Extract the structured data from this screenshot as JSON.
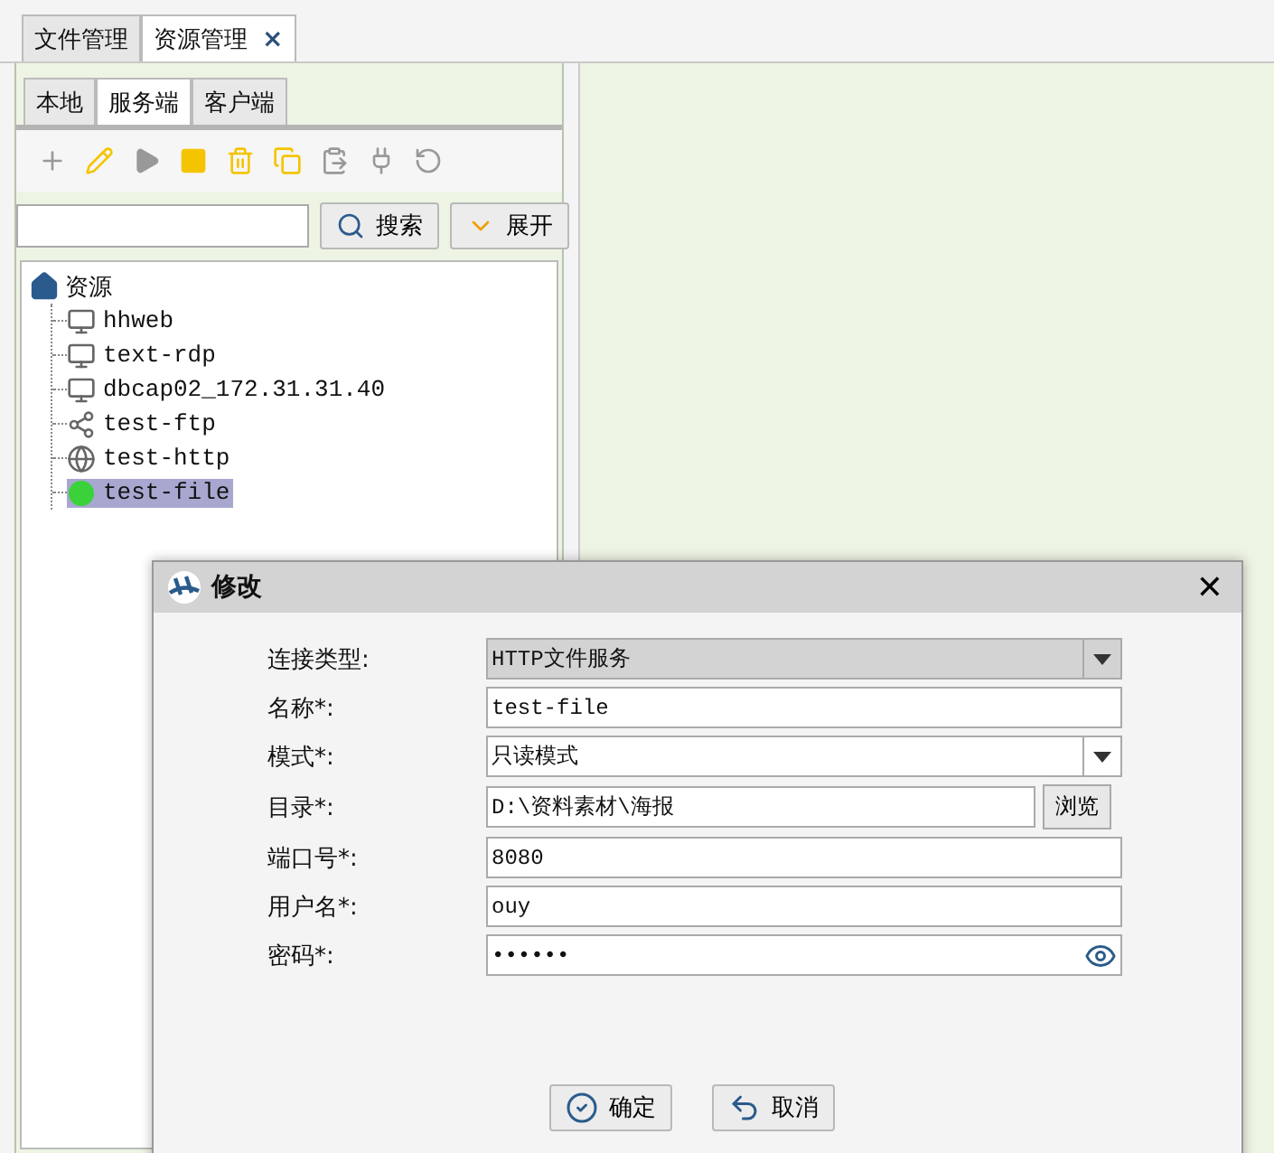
{
  "top_tabs": [
    {
      "label": "文件管理",
      "selected": false
    },
    {
      "label": "资源管理",
      "selected": true,
      "close": "×"
    }
  ],
  "sub_tabs": [
    {
      "label": "本地",
      "selected": false
    },
    {
      "label": "服务端",
      "selected": true
    },
    {
      "label": "客户端",
      "selected": false
    }
  ],
  "toolbar": [
    {
      "kind": "add",
      "disabled": true
    },
    {
      "kind": "edit",
      "disabled": false
    },
    {
      "kind": "start",
      "disabled": true
    },
    {
      "kind": "stop",
      "disabled": false
    },
    {
      "kind": "delete",
      "disabled": false
    },
    {
      "kind": "copy",
      "disabled": false
    },
    {
      "kind": "paste",
      "disabled": true
    },
    {
      "kind": "connect",
      "disabled": true
    },
    {
      "kind": "undo",
      "disabled": true
    }
  ],
  "search": {
    "button": "搜索",
    "expand": "展开"
  },
  "tree": {
    "label": "资源",
    "children": [
      {
        "label": "hhweb",
        "kind": "remote",
        "selected": false
      },
      {
        "label": "text-rdp",
        "kind": "remote",
        "selected": false
      },
      {
        "label": "dbcap02_172.31.31.40",
        "kind": "remote",
        "selected": false
      },
      {
        "label": "test-ftp",
        "kind": "share",
        "selected": false
      },
      {
        "label": "test-http",
        "kind": "web",
        "selected": false
      },
      {
        "label": "test-file",
        "kind": "file",
        "selected": true
      }
    ]
  },
  "dialog": {
    "title": "修改",
    "close": "✕",
    "fields": [
      {
        "label": "连接类型:",
        "kind": "select",
        "value": "HTTP文件服务",
        "disabled": true
      },
      {
        "label": "名称*:",
        "kind": "text",
        "value": "test-file",
        "disabled": false
      },
      {
        "label": "模式*:",
        "kind": "select",
        "value": "只读模式",
        "disabled": false
      },
      {
        "label": "目录*:",
        "kind": "browse",
        "value": "D:\\资料素材\\海报",
        "disabled": false,
        "button": "浏览"
      },
      {
        "label": "端口号*:",
        "kind": "text",
        "value": "8080",
        "disabled": false
      },
      {
        "label": "用户名*:",
        "kind": "text",
        "value": "ouy",
        "disabled": false
      },
      {
        "label": "密码*:",
        "kind": "password",
        "value": "••••••",
        "disabled": false
      }
    ],
    "buttons": [
      {
        "label": "确定",
        "kind": "ok"
      },
      {
        "label": "取消",
        "kind": "cancel"
      }
    ]
  }
}
